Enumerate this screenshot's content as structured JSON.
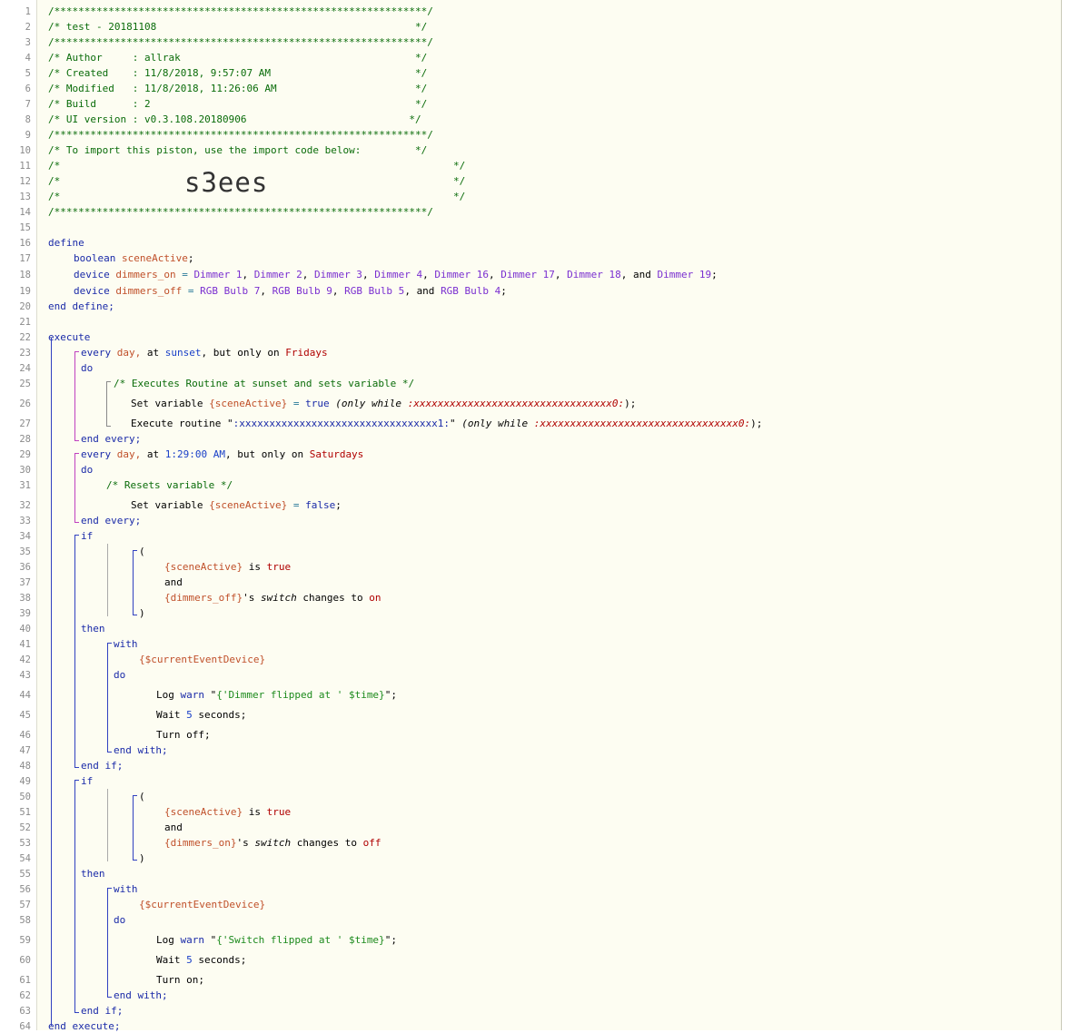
{
  "colors": {
    "editor_bg": "#fdfdf2",
    "comment": "#0a6c0a",
    "keyword": "#1a2aa8",
    "variable": "#c0502a",
    "device": "#7a2fd0",
    "string": "#1c8a1c",
    "value": "#b00000"
  },
  "header": {
    "stars": "/**************************************************************/",
    "title": "/* test - 20181108                                           */",
    "author": "/* Author     : allrak                                       */",
    "created": "/* Created    : 11/8/2018, 9:57:07 AM                        */",
    "modified": "/* Modified   : 11/8/2018, 11:26:06 AM                       */",
    "build": "/* Build      : 2                                            */",
    "ui_version": "/* UI version : v0.3.108.20180906                           */",
    "import_note": "/* To import this piston, use the import code below:         */",
    "blank_open": "/*",
    "blank_close": "*/",
    "import_code": "s3ees"
  },
  "code": {
    "define": "define",
    "bool_type": "boolean",
    "scene_active": "sceneActive",
    "semi": ";",
    "device_kw": "device",
    "dimmers_on": "dimmers_on",
    "dimmers_off": "dimmers_off",
    "eq": "=",
    "d1": "Dimmer 1",
    "d2": "Dimmer 2",
    "d3": "Dimmer 3",
    "d4": "Dimmer 4",
    "d16": "Dimmer 16",
    "d17": "Dimmer 17",
    "d18": "Dimmer 18",
    "d19": "Dimmer 19",
    "b7": "RGB Bulb 7",
    "b9": "RGB Bulb 9",
    "b5": "RGB Bulb 5",
    "b4": "RGB Bulb 4",
    "comma": ",",
    "and": "and",
    "end_define": "end define;",
    "execute": "execute",
    "every": "every",
    "day": "day,",
    "at": "at",
    "sunset": "sunset",
    "but_only_on": ", but only on",
    "fridays": "Fridays",
    "do": "do",
    "comment_routine": "/* Executes Routine at sunset and sets variable */",
    "set_variable": "Set variable",
    "scene_active_var": "{sceneActive}",
    "true_val": "true",
    "false_val": "false",
    "only_while": "(only while",
    "mask0": ":xxxxxxxxxxxxxxxxxxxxxxxxxxxxxxxxx0:",
    "mask1": ":xxxxxxxxxxxxxxxxxxxxxxxxxxxxxxxxx1:",
    "close_semi": ");",
    "execute_routine": "Execute routine",
    "quote": "\"",
    "end_every": "end every;",
    "time_0129": "1:29:00 AM",
    "saturdays": "Saturdays",
    "comment_reset": "/* Resets variable */",
    "if": "if",
    "open_paren": "(",
    "close_paren": ")",
    "is": "is",
    "dimmers_off_var": "{dimmers_off}",
    "dimmers_on_var": "{dimmers_on}",
    "s_switch": "'s",
    "switch_attr": "switch",
    "changes_to": "changes to",
    "on_val": "on",
    "off_val": "off",
    "then": "then",
    "with": "with",
    "current_event_device": "{$currentEventDevice}",
    "log": "Log",
    "warn": "warn",
    "log_msg_1": "{'Dimmer flipped at ' $time}",
    "log_msg_2": "{'Switch flipped at ' $time}",
    "wait": "Wait",
    "five": "5",
    "seconds": "seconds;",
    "turn_off": "Turn off;",
    "turn_on": "Turn on;",
    "end_with": "end with;",
    "end_if": "end if;",
    "end_execute": "end execute;"
  }
}
